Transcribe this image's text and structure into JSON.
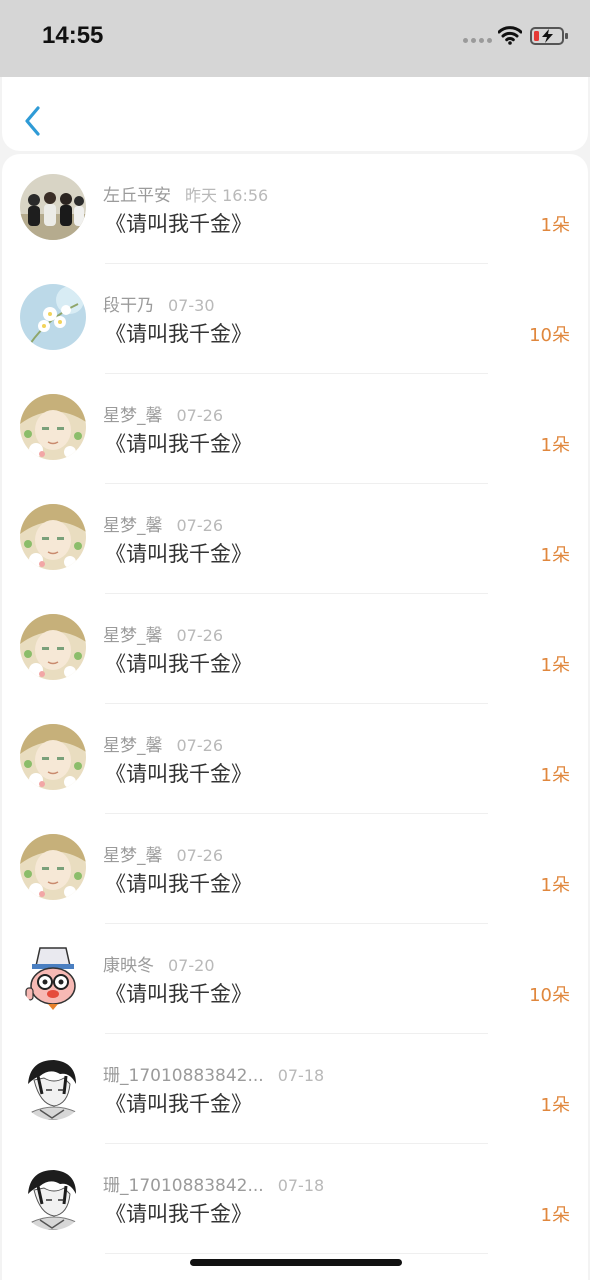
{
  "status_bar": {
    "time": "14:55"
  },
  "items": [
    {
      "avatar": "group-photo-avatar",
      "name": "左丘平安",
      "date": "昨天 16:56",
      "title": "《请叫我千金》",
      "count": "1朵"
    },
    {
      "avatar": "flower-avatar",
      "name": "段干乃",
      "date": "07-30",
      "title": "《请叫我千金》",
      "count": "10朵"
    },
    {
      "avatar": "anime-girl-avatar",
      "name": "星梦_馨",
      "date": "07-26",
      "title": "《请叫我千金》",
      "count": "1朵"
    },
    {
      "avatar": "anime-girl-avatar",
      "name": "星梦_馨",
      "date": "07-26",
      "title": "《请叫我千金》",
      "count": "1朵"
    },
    {
      "avatar": "anime-girl-avatar",
      "name": "星梦_馨",
      "date": "07-26",
      "title": "《请叫我千金》",
      "count": "1朵"
    },
    {
      "avatar": "anime-girl-avatar",
      "name": "星梦_馨",
      "date": "07-26",
      "title": "《请叫我千金》",
      "count": "1朵"
    },
    {
      "avatar": "anime-girl-avatar",
      "name": "星梦_馨",
      "date": "07-26",
      "title": "《请叫我千金》",
      "count": "1朵"
    },
    {
      "avatar": "cartoon-mascot-avatar",
      "name": "康映冬",
      "date": "07-20",
      "title": "《请叫我千金》",
      "count": "10朵"
    },
    {
      "avatar": "sketch-boy-avatar",
      "name": "珊_17010883842...",
      "date": "07-18",
      "title": "《请叫我千金》",
      "count": "1朵"
    },
    {
      "avatar": "sketch-boy-avatar",
      "name": "珊_17010883842...",
      "date": "07-18",
      "title": "《请叫我千金》",
      "count": "1朵"
    }
  ],
  "colors": {
    "accent_blue": "#2f9bd6",
    "count_orange": "#e0873d",
    "name_gray": "#9b9b9b",
    "title_text": "#333333"
  }
}
